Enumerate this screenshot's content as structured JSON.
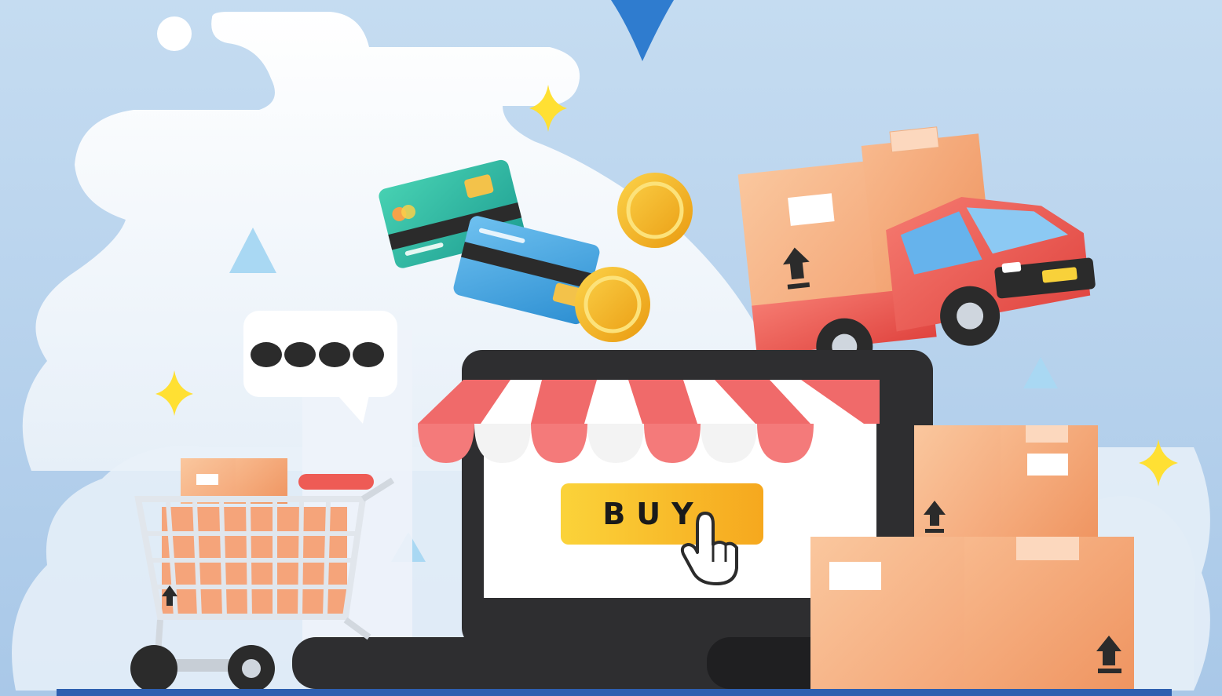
{
  "buy_button": {
    "label": "BUY"
  },
  "chat_bubble": {
    "dots": 4
  },
  "colors": {
    "background": "#b9d5ee",
    "cloud": "#ffffff",
    "laptop": "#2e2e30",
    "awning_red": "#f06a6a",
    "buy_yellow": "#f9c72a",
    "box": "#f6b488",
    "truck": "#ee5b55",
    "coin": "#f5b51c",
    "card_green": "#2ebfa5",
    "card_blue": "#3fa5e0",
    "sparkle": "#ffe033",
    "floor_bar": "#2d5fb0"
  },
  "icons": [
    "cart-icon",
    "credit-card-icon",
    "coin-icon",
    "truck-icon",
    "box-icon",
    "sparkle-icon",
    "hand-cursor-icon",
    "this-side-up-icon"
  ]
}
